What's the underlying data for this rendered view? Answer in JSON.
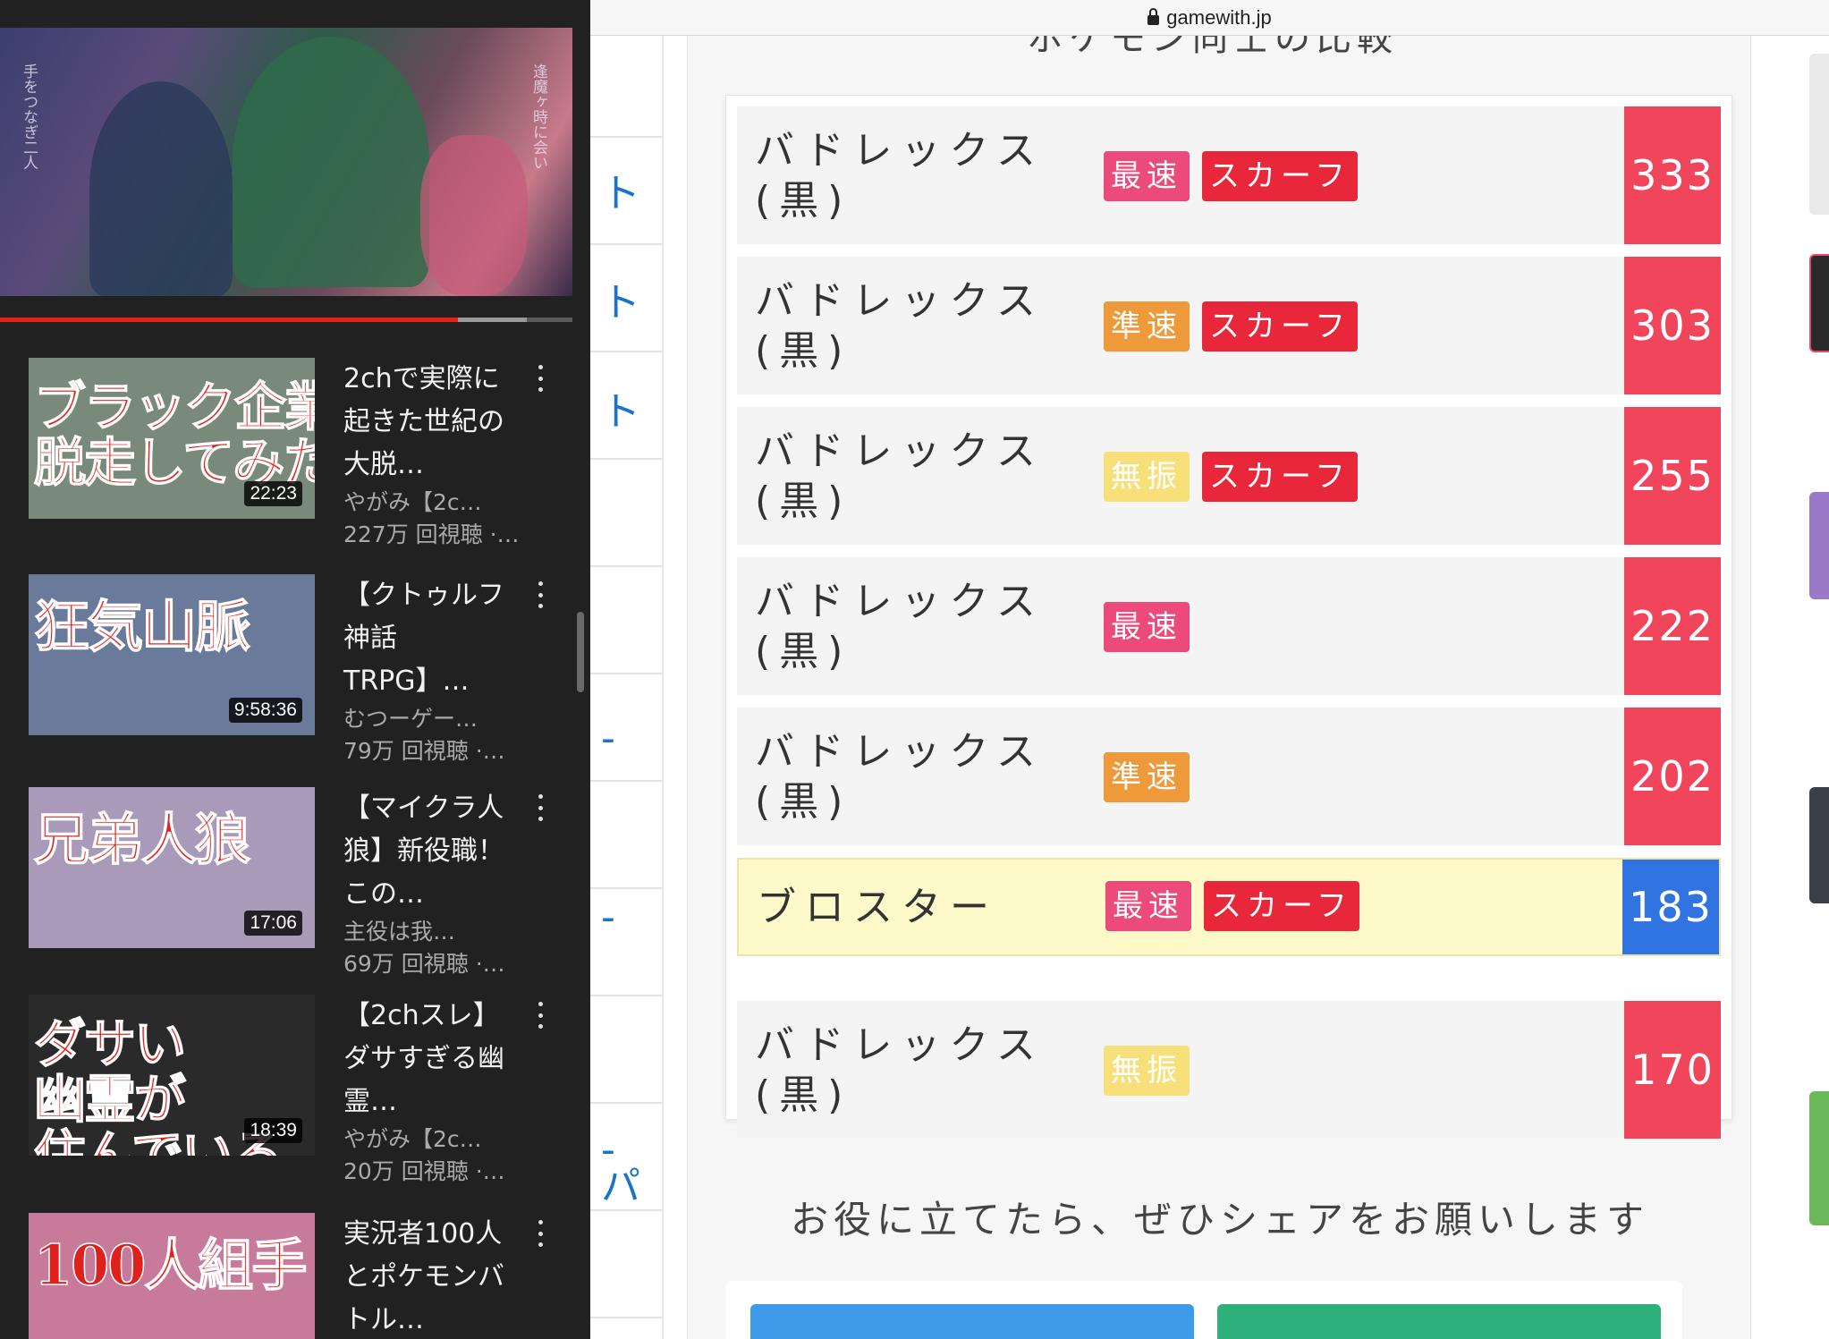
{
  "browser": {
    "url": "gamewith.jp",
    "sidebar_glyphs": [
      "ト",
      "ト",
      "ト",
      "　",
      "-",
      "-",
      "-",
      "パ"
    ]
  },
  "youtube": {
    "now_playing": {
      "caption_left": "手をつなぎ二人",
      "caption_right": "逢魔ヶ時に会い",
      "progress": 0.8,
      "buffered": 0.92
    },
    "items": [
      {
        "thumb_text": "ブラック企業から 脱走してみた",
        "duration": "22:23",
        "title": "2chで実際に起きた世紀の大脱…",
        "channel": "やがみ【2c…",
        "views": "227万 回視聴 ·…",
        "thumb_bg": "#7a8a7a"
      },
      {
        "thumb_text": "狂気山脈",
        "duration": "9:58:36",
        "title": "【クトゥルフ神話TRPG】…",
        "channel": "むつーゲー…",
        "views": "79万 回視聴 ·…",
        "thumb_bg": "#6a7a9a"
      },
      {
        "thumb_text": "兄弟人狼",
        "duration": "17:06",
        "title": "【マイクラ人狼】新役職！この…",
        "channel": "主役は我…",
        "views": "69万 回視聴 ·…",
        "thumb_bg": "#a89ab8"
      },
      {
        "thumb_text": "ダサい 幽霊が 住んでいる",
        "duration": "18:39",
        "title": "【2chスレ】ダサすぎる幽霊…",
        "channel": "やがみ【2c…",
        "views": "20万 回視聴 ·…",
        "thumb_bg": "#2a2a2a"
      },
      {
        "thumb_text": "100人組手",
        "duration": "",
        "title": "実況者100人とポケモンバトル…",
        "channel": "",
        "views": "",
        "thumb_bg": "#c87a9a"
      }
    ]
  },
  "speed_table": {
    "heading": "ポケモン同士の比較",
    "rows": [
      {
        "name": "バドレックス\n(黒)",
        "tags": [
          {
            "label": "最速",
            "color": "#ec4a7a"
          },
          {
            "label": "スカーフ",
            "color": "#e8283a"
          }
        ],
        "value": "333",
        "value_color": "#f0455a",
        "highlight": false
      },
      {
        "name": "バドレックス\n(黒)",
        "tags": [
          {
            "label": "準速",
            "color": "#ef9a3a"
          },
          {
            "label": "スカーフ",
            "color": "#e8283a"
          }
        ],
        "value": "303",
        "value_color": "#f0455a",
        "highlight": false
      },
      {
        "name": "バドレックス\n(黒)",
        "tags": [
          {
            "label": "無振",
            "color": "#f7df7a"
          },
          {
            "label": "スカーフ",
            "color": "#e8283a"
          }
        ],
        "value": "255",
        "value_color": "#f0455a",
        "highlight": false
      },
      {
        "name": "バドレックス\n(黒)",
        "tags": [
          {
            "label": "最速",
            "color": "#ec4a7a"
          }
        ],
        "value": "222",
        "value_color": "#f0455a",
        "highlight": false
      },
      {
        "name": "バドレックス\n(黒)",
        "tags": [
          {
            "label": "準速",
            "color": "#ef9a3a"
          }
        ],
        "value": "202",
        "value_color": "#f0455a",
        "highlight": false
      },
      {
        "name": "ブロスター",
        "tags": [
          {
            "label": "最速",
            "color": "#ec4a7a"
          },
          {
            "label": "スカーフ",
            "color": "#e8283a"
          }
        ],
        "value": "183",
        "value_color": "#2f74e0",
        "highlight": true
      },
      {
        "name": "バドレックス\n(黒)",
        "tags": [
          {
            "label": "無振",
            "color": "#f7df7a"
          }
        ],
        "value": "170",
        "value_color": "#f0455a",
        "highlight": false
      }
    ]
  },
  "share": {
    "text": "お役に立てたら、ぜひシェアをお願いします",
    "buttons": [
      {
        "color": "#3d9be9"
      },
      {
        "color": "#2db07a"
      }
    ]
  }
}
